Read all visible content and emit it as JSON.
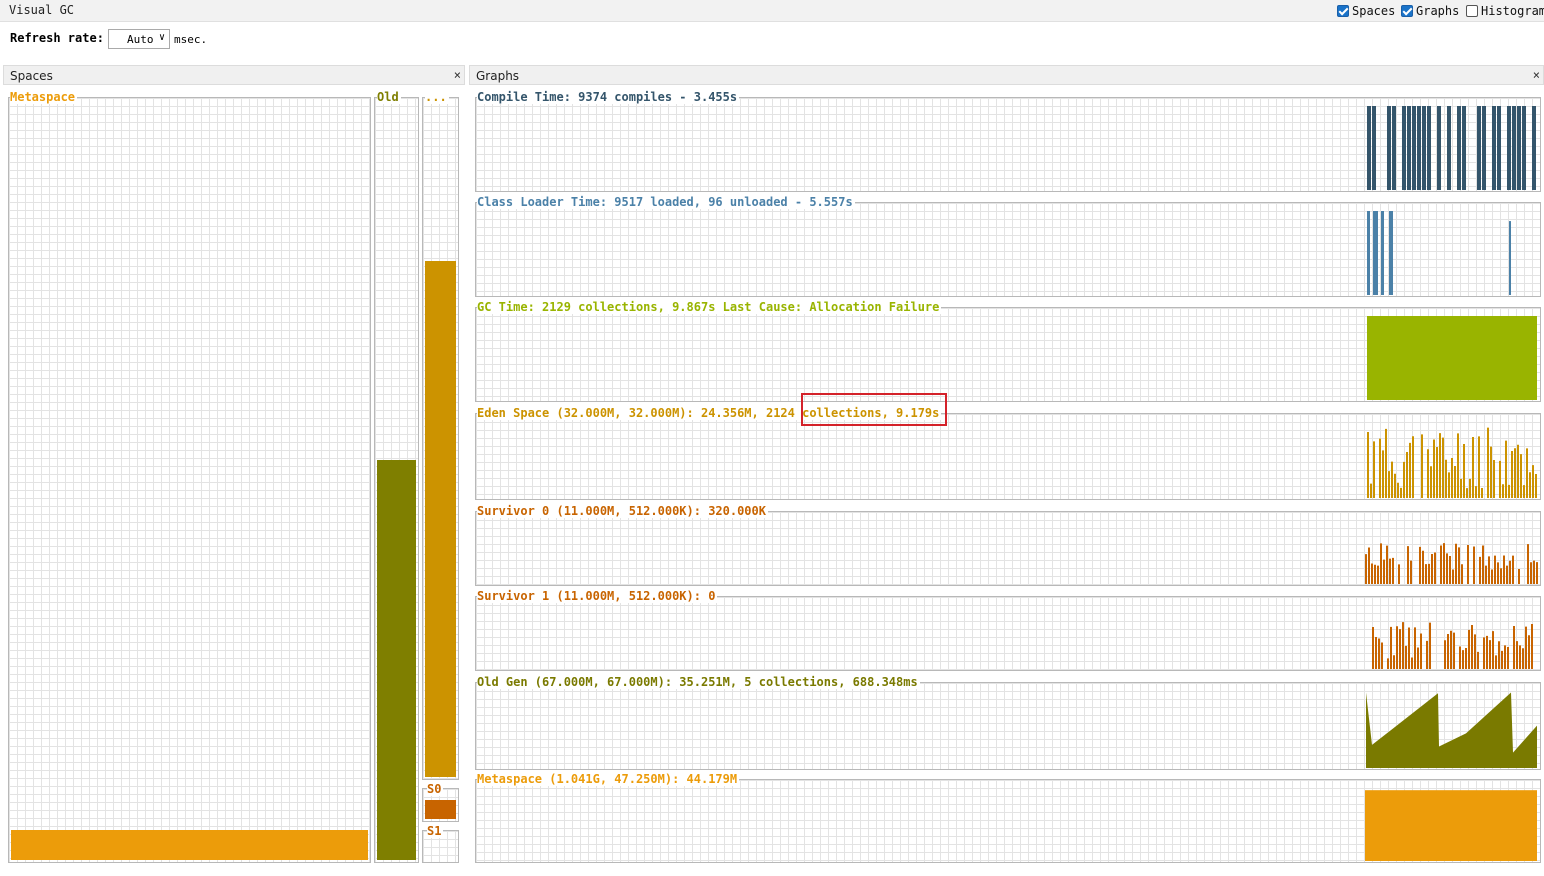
{
  "window": {
    "title": "Visual GC",
    "checkboxes": [
      {
        "label": "Spaces",
        "checked": true
      },
      {
        "label": "Graphs",
        "checked": true
      },
      {
        "label": "Histogram",
        "checked": false
      }
    ]
  },
  "refresh": {
    "label": "Refresh rate:",
    "value": "Auto",
    "unit": "msec."
  },
  "spaces_panel": {
    "title": "Spaces",
    "close": "×",
    "metaspace_label": "Metaspace",
    "metaspace_fill": 0.04,
    "old_label": "Old",
    "old_fill": 0.525,
    "eden_label": "...",
    "eden_fill": 0.76,
    "s0_label": "S0",
    "s0_fill": 0.62,
    "s1_label": "S1",
    "s1_fill": 0.0
  },
  "graphs_panel": {
    "title": "Graphs",
    "close": "×",
    "graphs": [
      {
        "label": "Compile Time: 9374 compiles - 3.455s",
        "color": "#34556b"
      },
      {
        "label": "Class Loader Time: 9517 loaded, 96 unloaded - 5.557s",
        "color": "#4b81a8"
      },
      {
        "label": "GC Time: 2129 collections, 9.867s  Last Cause: Allocation Failure",
        "color": "#99b400"
      },
      {
        "label": "Eden Space (32.000M, 32.000M): 24.356M, 2124 collections, 9.179s",
        "color": "#cc9300"
      },
      {
        "label": "Survivor 0 (11.000M, 512.000K): 320.000K",
        "color": "#c86400"
      },
      {
        "label": "Survivor 1 (11.000M, 512.000K): 0",
        "color": "#c86400"
      },
      {
        "label": "Old Gen (67.000M, 67.000M): 35.251M, 5 collections, 688.348ms",
        "color": "#7a7a00"
      },
      {
        "label": "Metaspace (1.041G, 47.250M): 44.179M",
        "color": "#ec9c0a"
      }
    ]
  },
  "colors": {
    "metaspace": "#ec9c0a",
    "old": "#7f7f00",
    "eden": "#cc9300",
    "survivor": "#c86400",
    "highlight": "#d4222a"
  }
}
